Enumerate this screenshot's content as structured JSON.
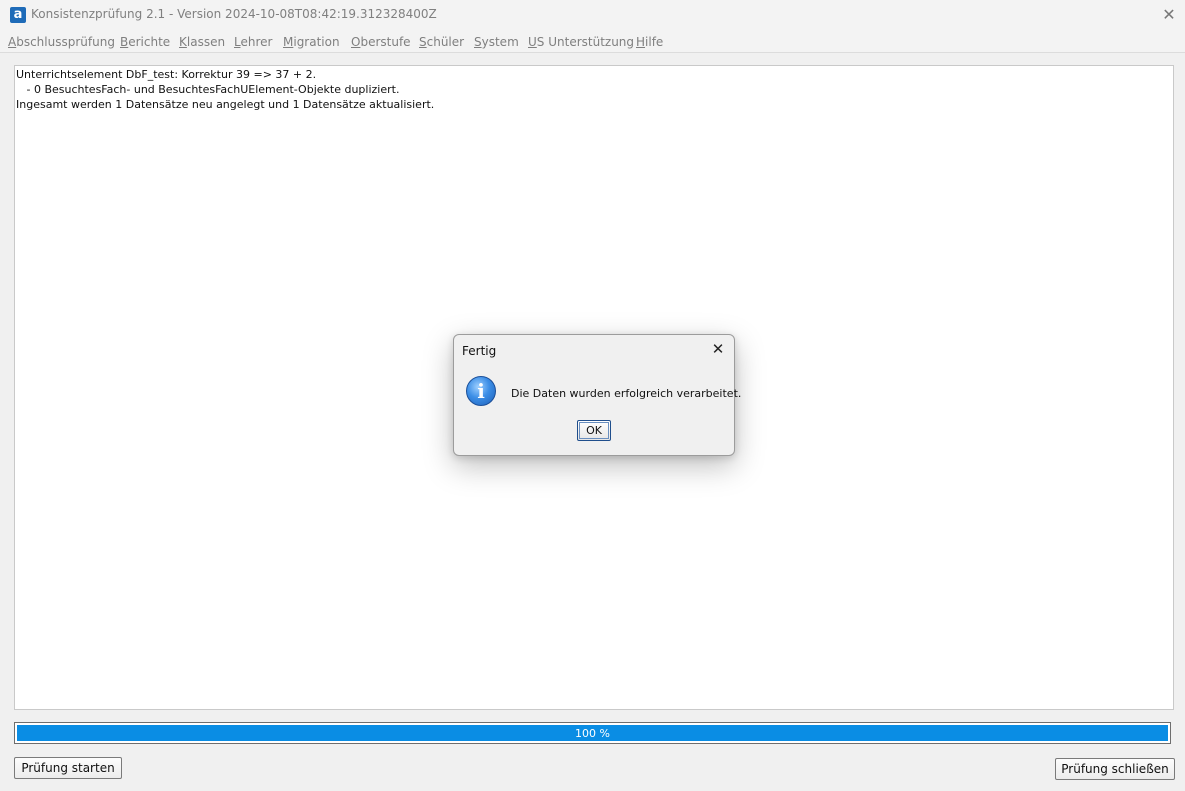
{
  "window": {
    "icon_letter": "a",
    "title": "Konsistenzprüfung 2.1 - Version 2024-10-08T08:42:19.312328400Z",
    "close_glyph": "✕"
  },
  "menu": [
    {
      "first": "A",
      "rest": "bschlussprüfung"
    },
    {
      "first": "B",
      "rest": "erichte"
    },
    {
      "first": "K",
      "rest": "lassen"
    },
    {
      "first": "L",
      "rest": "ehrer"
    },
    {
      "first": "M",
      "rest": "igration"
    },
    {
      "first": "O",
      "rest": "berstufe"
    },
    {
      "first": "S",
      "rest": "chüler"
    },
    {
      "first": "S",
      "rest": "ystem"
    },
    {
      "first": "U",
      "rest": "S Unterstützung"
    },
    {
      "first": "H",
      "rest": "ilfe"
    }
  ],
  "log": {
    "lines": [
      "Unterrichtselement DbF_test: Korrektur 39 => 37 + 2.",
      "   - 0 BesuchtesFach- und BesuchtesFachUElement-Objekte dupliziert.",
      "Ingesamt werden 1 Datensätze neu angelegt und 1 Datensätze aktualisiert."
    ]
  },
  "progress": {
    "value_percent": 100,
    "label": "100 %",
    "color": "#0a8de4"
  },
  "buttons": {
    "start": "Prüfung starten",
    "close": "Prüfung schließen"
  },
  "dialog": {
    "title": "Fertig",
    "close_glyph": "✕",
    "icon": "info-icon",
    "icon_letter": "i",
    "message": "Die Daten wurden erfolgreich verarbeitet.",
    "ok_label": "OK"
  }
}
